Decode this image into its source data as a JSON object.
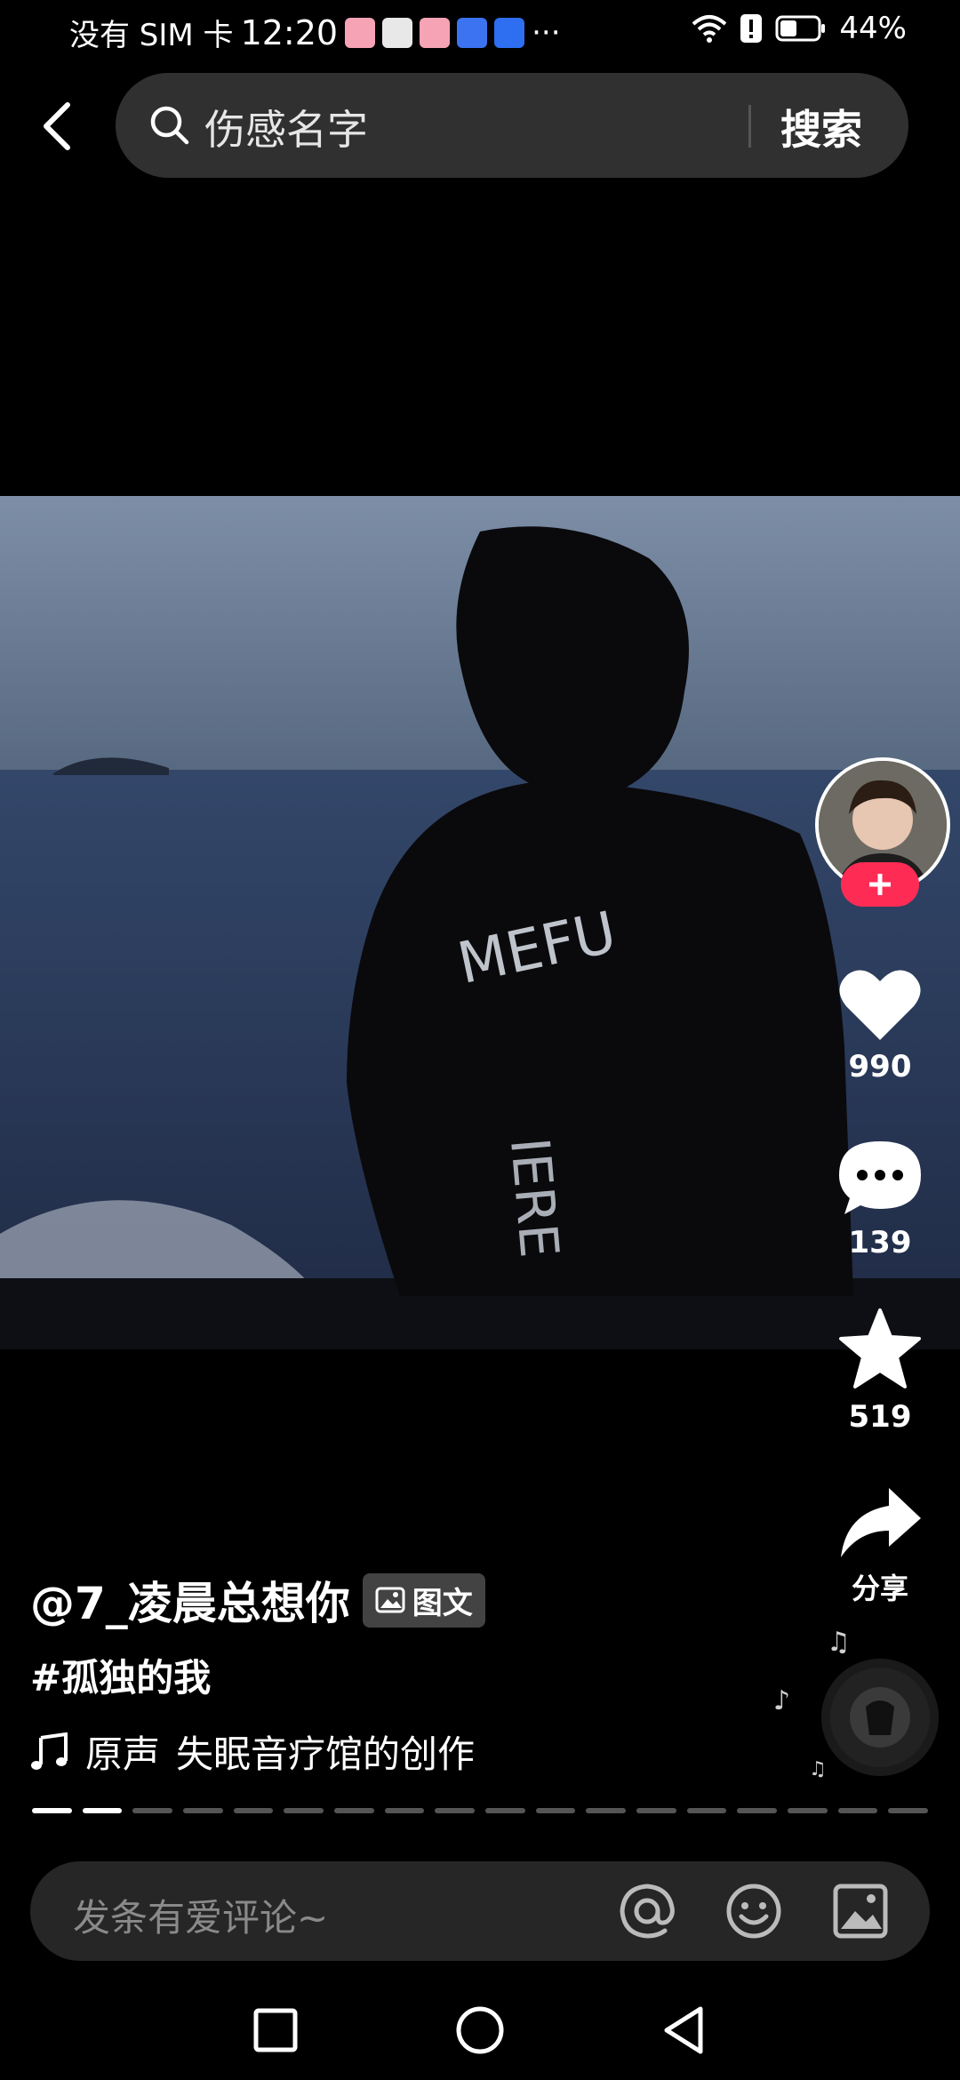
{
  "status_bar": {
    "carrier": "没有 SIM 卡",
    "time": "12:20",
    "more": "···",
    "battery": "44%"
  },
  "search": {
    "query": "伤感名字",
    "button_label": "搜索"
  },
  "actions": {
    "like_count": "990",
    "comment_count": "139",
    "favorite_count": "519",
    "share_label": "分享"
  },
  "post": {
    "author": "@7_凌晨总想你",
    "type_badge": "图文",
    "hashtag": "#孤独的我",
    "music_prefix": "原声",
    "music_text": "失眠音疗馆的创作"
  },
  "progress": {
    "total_slides": 18,
    "viewed": 2
  },
  "comment": {
    "placeholder": "发条有爱评论~"
  },
  "colors": {
    "accent": "#fe2c55",
    "background": "#000000"
  }
}
